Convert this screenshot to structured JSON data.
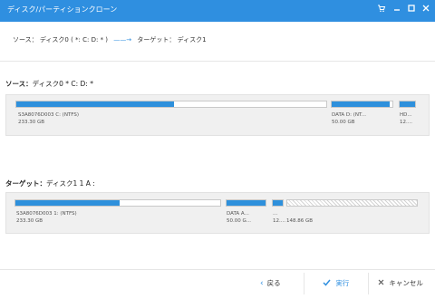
{
  "window": {
    "title": "ディスク/パーティションクローン"
  },
  "breadcrumb": {
    "source_label": "ソース：",
    "source_value": "ディスク0 ( *: C: D: * )",
    "arrow": "——→",
    "target_label": "ターゲット：",
    "target_value": "ディスク1"
  },
  "source_section": {
    "title": "ソース：",
    "disk": "ディスク0 * C: D: *",
    "partitions": [
      {
        "label": "S3A8076D003 C: (NTFS)",
        "size": "233.30 GB",
        "used": 0.51,
        "kind": "primary"
      },
      {
        "label": "DATA D: (NT...",
        "size": "50.00 GB",
        "used": 0.95,
        "kind": "primary"
      },
      {
        "label": "HD...",
        "size": "12....",
        "used": 1.0,
        "kind": "primary"
      }
    ]
  },
  "target_section": {
    "title": "ターゲット：",
    "disk": "ディスク1 1 A :",
    "partitions": [
      {
        "label": "S3A8076D003 1: (NTFS)",
        "size": "233.30 GB",
        "used": 0.51,
        "kind": "primary"
      },
      {
        "label": "DATA A...",
        "size": "50.00 G...",
        "used": 1.0,
        "kind": "primary"
      },
      {
        "label": "...",
        "size": "12....",
        "used": 1.0,
        "kind": "primary"
      },
      {
        "label": "",
        "size": "148.86 GB",
        "used": 0,
        "kind": "unallocated"
      }
    ]
  },
  "footer": {
    "back_label": "戻る",
    "run_label": "実行",
    "cancel_label": "キャンセル"
  },
  "colors": {
    "accent": "#2f8fe0",
    "used_fill": "#2e90dc"
  }
}
